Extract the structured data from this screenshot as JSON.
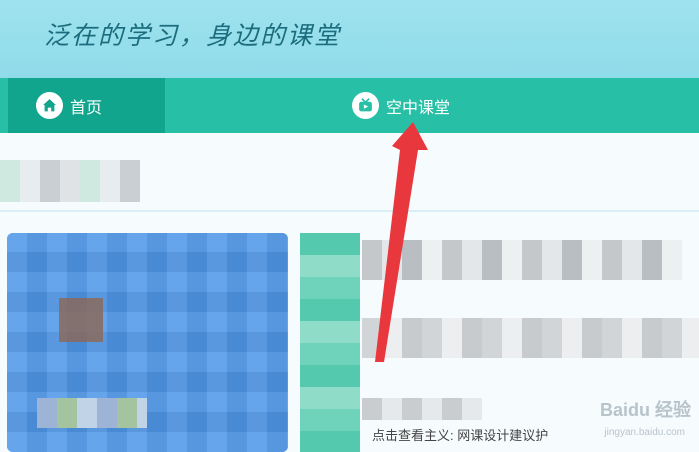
{
  "banner": {
    "slogan": "泛在的学习，身边的课堂"
  },
  "nav": {
    "home": {
      "label": "首页",
      "icon": "home-icon"
    },
    "sky_class": {
      "label": "空中课堂",
      "icon": "tv-icon"
    }
  },
  "content": {
    "card_hint": "点击查看主义: 网课设计建议护"
  },
  "watermark": {
    "brand": "Baidu 经验",
    "sub": "jingyan.baidu.com"
  },
  "colors": {
    "banner": "#9fe2ee",
    "nav_bg": "#27c0a6",
    "nav_active": "#12a58d",
    "arrow": "#e8383d"
  }
}
